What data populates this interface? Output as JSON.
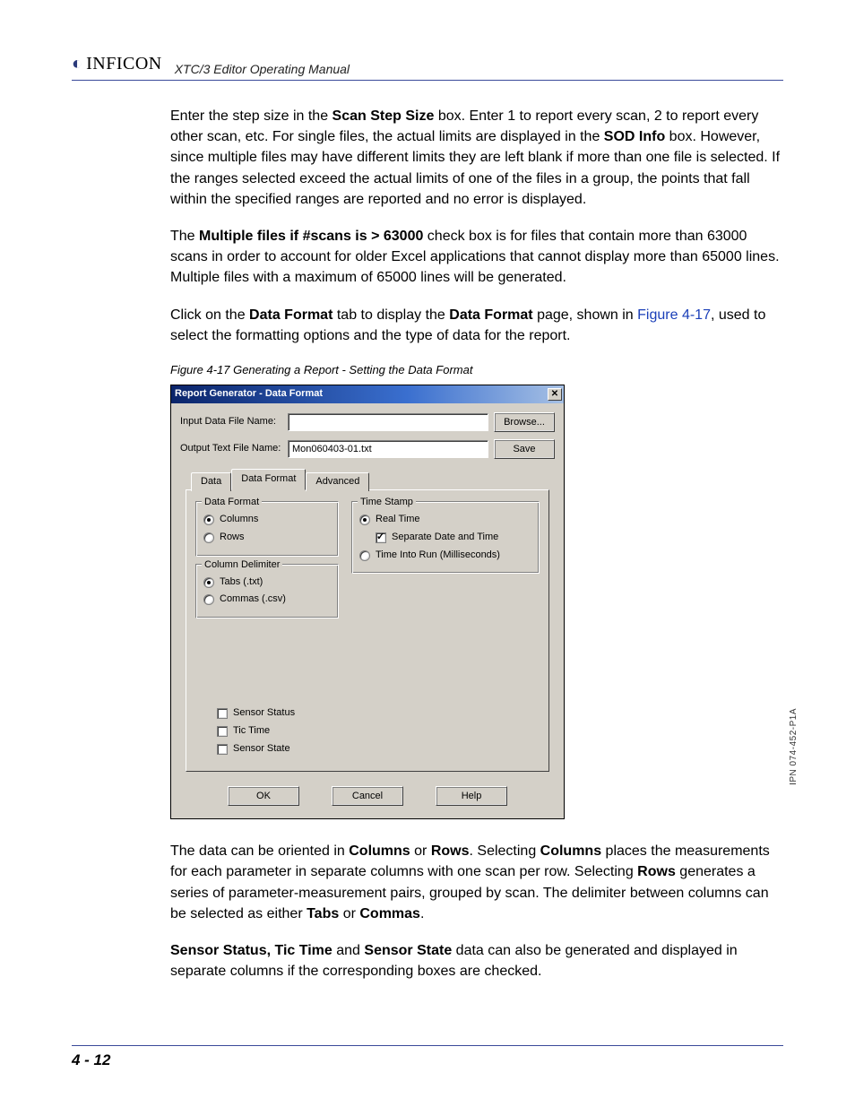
{
  "header": {
    "logo_text": "INFICON",
    "manual_title": "XTC/3 Editor Operating Manual"
  },
  "para1": {
    "t1": "Enter the step size in the ",
    "b1": "Scan Step Size",
    "t2": " box. Enter 1 to report every scan, 2 to report every other scan, etc. For single files, the actual limits are displayed in the ",
    "b2": "SOD Info",
    "t3": " box. However, since multiple files may have different limits they are left blank if more than one file is selected. If the ranges selected exceed the actual limits of one of the files in a group, the points that fall within the specified ranges are reported and no error is displayed."
  },
  "para2": {
    "t1": "The ",
    "b1": "Multiple files if #scans is > 63000",
    "t2": " check box is for files that contain more than 63000 scans in order to account for older Excel applications that cannot display more than 65000 lines. Multiple files with a maximum of 65000 lines will be generated."
  },
  "para3": {
    "t1": "Click on the ",
    "b1": "Data Format",
    "t2": " tab to display the ",
    "b2": "Data Format",
    "t3": " page, shown in ",
    "link": "Figure 4-17",
    "t4": ", used to select the formatting options and the type of data for the report."
  },
  "fig_caption": "Figure 4-17  Generating a Report - Setting the Data Format",
  "dialog": {
    "title": "Report Generator - Data Format",
    "close": "✕",
    "input_label": "Input Data File Name:",
    "input_value": "",
    "browse": "Browse...",
    "output_label": "Output Text File Name:",
    "output_value": "Mon060403-01.txt",
    "save": "Save",
    "tabs": {
      "data": "Data",
      "data_format": "Data Format",
      "advanced": "Advanced"
    },
    "group_data_format": "Data Format",
    "radio_columns": "Columns",
    "radio_rows": "Rows",
    "group_col_delim": "Column Delimiter",
    "radio_tabs": "Tabs (.txt)",
    "radio_commas": "Commas (.csv)",
    "group_timestamp": "Time Stamp",
    "radio_realtime": "Real Time",
    "chk_separate": "Separate Date and Time",
    "radio_ms": "Time Into Run (Milliseconds)",
    "chk_sensor_status": "Sensor Status",
    "chk_tic_time": "Tic Time",
    "chk_sensor_state": "Sensor State",
    "ok": "OK",
    "cancel": "Cancel",
    "help": "Help"
  },
  "para4": {
    "t1": "The data can be oriented in ",
    "b1": "Columns",
    "t2": " or ",
    "b2": "Rows",
    "t3": ". Selecting ",
    "b3": "Columns",
    "t4": " places the measurements for each parameter in separate columns with one scan per row. Selecting ",
    "b4": "Rows",
    "t5": " generates a series of parameter-measurement pairs, grouped by scan. The delimiter between columns can be selected as either ",
    "b5": "Tabs",
    "t6": " or ",
    "b6": "Commas",
    "t7": "."
  },
  "para5": {
    "b1": "Sensor Status, Tic Time",
    "t1": " and ",
    "b2": "Sensor State",
    "t2": " data can also be generated and displayed in separate columns if the corresponding boxes are checked."
  },
  "side_note": "IPN 074-452-P1A",
  "page_number": "4 - 12"
}
